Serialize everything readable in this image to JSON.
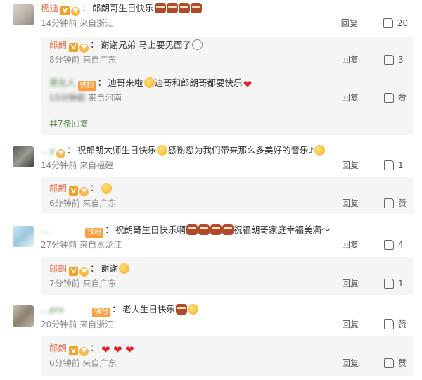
{
  "threads": [
    {
      "root": {
        "name": "杨迪",
        "text": "郎朗哥生日快乐",
        "emojis": [
          "cake",
          "cake",
          "cake",
          "cake"
        ],
        "time": "14分钟前",
        "location": "来自浙江",
        "reply_label": "回复",
        "likes": "20"
      },
      "replies": [
        {
          "name": "郎朗",
          "text": "谢谢兄弟 马上要见面了",
          "emojis": [
            "glasses"
          ],
          "time": "8分钟前",
          "location": "来自广东",
          "reply_label": "回复",
          "likes": "3"
        },
        {
          "name": "黑化人",
          "fan_badge": "铁粉",
          "text1": "迪哥来啦",
          "text2": "迪哥和郎朗哥都要快乐",
          "time": "15分钟前",
          "location": "来自河南",
          "reply_label": "回复",
          "likes": "赞"
        }
      ],
      "more_label": "共7条回复"
    },
    {
      "root": {
        "name": "…y",
        "text": "祝郎朗大师生日快乐",
        "text2": "感谢您为我们带来那么多美好的音乐",
        "time": "14分钟前",
        "location": "来自福建",
        "reply_label": "回复",
        "likes": "1"
      },
      "replies": [
        {
          "name": "郎朗",
          "time": "6分钟前",
          "location": "来自广东",
          "reply_label": "回复",
          "likes": "赞"
        }
      ]
    },
    {
      "root": {
        "name": "…",
        "fan_badge": "铁粉",
        "text": "祝朗哥生日快乐啊",
        "text2": "祝福朗哥家庭幸福美满～",
        "time": "27分钟前",
        "location": "来自黑龙江",
        "reply_label": "回复",
        "likes": "4"
      },
      "replies": [
        {
          "name": "郎朗",
          "text": "谢谢",
          "time": "7分钟前",
          "location": "来自广东",
          "reply_label": "回复",
          "likes": "1"
        }
      ]
    },
    {
      "root": {
        "name": "…pro",
        "fan_badge": "铁粉",
        "text": "老大生日快乐",
        "time": "20分钟前",
        "location": "来自浙江",
        "reply_label": "回复",
        "likes": "赞"
      },
      "replies": [
        {
          "name": "郎朗",
          "time": "6分钟前",
          "location": "来自广东",
          "reply_label": "回复",
          "likes": "赞"
        }
      ]
    }
  ],
  "colors": {
    "name": "#eb7350",
    "reply_bg": "#f5f5f5",
    "heart": "#e8202a"
  }
}
